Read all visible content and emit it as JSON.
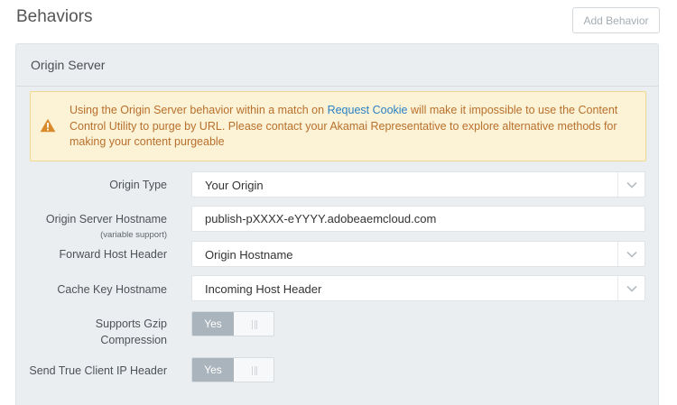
{
  "page": {
    "title": "Behaviors",
    "add_behavior_label": "Add Behavior"
  },
  "panel": {
    "title": "Origin Server",
    "warning": {
      "text_before": "Using the Origin Server behavior within a match on ",
      "link_text": "Request Cookie",
      "text_after": " will make it impossible to use the Content Control Utility to purge by URL. Please contact your Akamai Representative to explore alternative methods for making your content purgeable",
      "icon": "warning-triangle-icon",
      "colors": {
        "background": "#fcf2d5",
        "text": "#b8702d",
        "link": "#2c80c3",
        "icon": "#d98b2b"
      }
    },
    "fields": {
      "origin_type": {
        "label": "Origin Type",
        "value": "Your Origin"
      },
      "origin_hostname": {
        "label": "Origin Server Hostname",
        "sublabel": "(variable support)",
        "value": "publish-pXXXX-eYYYY.adobeaemcloud.com"
      },
      "forward_host_header": {
        "label": "Forward Host Header",
        "value": "Origin Hostname"
      },
      "cache_key_hostname": {
        "label": "Cache Key Hostname",
        "value": "Incoming Host Header"
      },
      "gzip": {
        "label_line1": "Supports Gzip",
        "label_line2": "Compression",
        "toggle_label": "Yes"
      },
      "true_client_ip": {
        "label": "Send True Client IP Header",
        "toggle_label": "Yes"
      }
    }
  }
}
